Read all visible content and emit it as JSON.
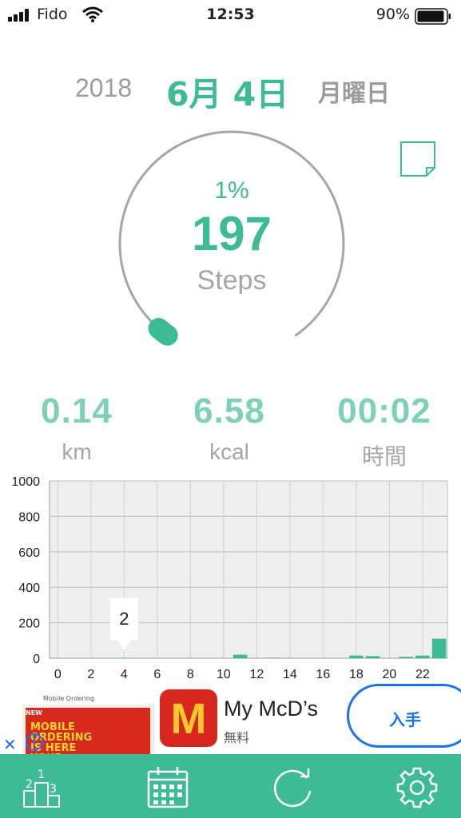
{
  "status_bar": {
    "carrier": "Fido",
    "time": "12:53",
    "battery": "90%"
  },
  "header": {
    "year": "2018",
    "month_day": "6月 4日",
    "weekday": "月曜日"
  },
  "gauge": {
    "percent_text": "1%",
    "steps": "197",
    "steps_label": "Steps",
    "progress": 0.01
  },
  "stats": [
    {
      "value": "0.14",
      "unit": "km"
    },
    {
      "value": "6.58",
      "unit": "kcal"
    },
    {
      "value": "00:02",
      "unit": "時間"
    }
  ],
  "chart_data": {
    "type": "bar",
    "x_ticks": [
      "0",
      "2",
      "4",
      "6",
      "8",
      "10",
      "12",
      "14",
      "16",
      "18",
      "20",
      "22"
    ],
    "y_ticks": [
      "0",
      "200",
      "400",
      "600",
      "800",
      "1000"
    ],
    "ylim": [
      0,
      1000
    ],
    "xlim": [
      -0.5,
      23.5
    ],
    "x": [
      4,
      11,
      13,
      18,
      19,
      21,
      22,
      23
    ],
    "values": [
      2,
      20,
      3,
      15,
      12,
      8,
      15,
      110
    ],
    "tooltip": {
      "x": 4,
      "label": "2"
    },
    "bar_color": "#3dbb95",
    "grid": true
  },
  "ad": {
    "image_caption": "Mobile Ordering",
    "image_headline": "MOBILE ORDERING IS HERE YOUR FAVES",
    "badge": "NEW",
    "logo_letter": "M",
    "app_name": "My McD’s",
    "price": "無料",
    "get_label": "入手",
    "close_glyph": "✕",
    "info_glyph": "i"
  },
  "tabbar": {
    "color": "#3dbb95",
    "items": [
      "ranking-icon",
      "calendar-icon",
      "refresh-icon",
      "settings-icon"
    ]
  },
  "colors": {
    "accent": "#3dbb95",
    "accent_light": "#7ed1b8",
    "muted": "#a6a6a6"
  }
}
